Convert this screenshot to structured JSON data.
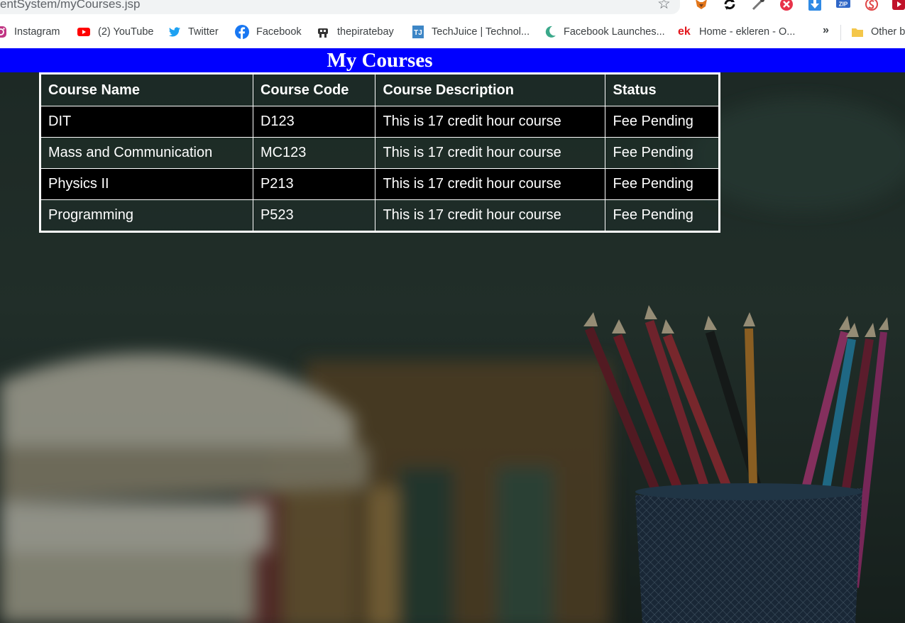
{
  "browser": {
    "url": "entSystem/myCourses.jsp",
    "bookmarks": [
      {
        "label": "Instagram",
        "icon": "instagram-icon"
      },
      {
        "label": "(2) YouTube",
        "icon": "youtube-icon"
      },
      {
        "label": "Twitter",
        "icon": "twitter-icon"
      },
      {
        "label": "Facebook",
        "icon": "facebook-icon"
      },
      {
        "label": "thepiratebay",
        "icon": "pirate-icon"
      },
      {
        "label": "TechJuice | Technol...",
        "icon": "techjuice-icon"
      },
      {
        "label": "Facebook Launches...",
        "icon": "moon-icon"
      },
      {
        "label": "Home - ekleren - O...",
        "icon": "ek-icon",
        "icon_text": "ek"
      },
      {
        "label": "Other b",
        "icon": "folder-icon"
      }
    ],
    "overflow_label": "»",
    "zip_label": "ZIP"
  },
  "page": {
    "title": "My Courses"
  },
  "table": {
    "headers": [
      "Course Name",
      "Course Code",
      "Course Description",
      "Status"
    ],
    "rows": [
      [
        "DIT",
        "D123",
        "This is 17 credit hour course",
        "Fee Pending"
      ],
      [
        "Mass and Communication",
        "MC123",
        "This is 17 credit hour course",
        "Fee Pending"
      ],
      [
        "Physics II",
        "P213",
        "This is 17 credit hour course",
        "Fee Pending"
      ],
      [
        "Programming",
        "P523",
        "This is 17 credit hour course",
        "Fee Pending"
      ]
    ]
  },
  "colors": {
    "header_bar": "#0000ff",
    "dark_row": "#000000",
    "text": "#ffffff"
  }
}
